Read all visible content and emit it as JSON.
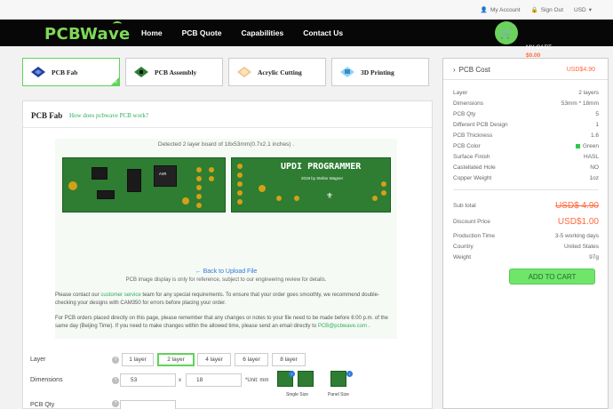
{
  "topbar": {
    "my_account": "My Account",
    "sign_out": "Sign Out",
    "currency": "USD"
  },
  "nav": {
    "logo": "PCBWave",
    "items": [
      "Home",
      "PCB Quote",
      "Capabilities",
      "Contact Us"
    ],
    "cart_label": "MY CART",
    "cart_amount": "$0.00"
  },
  "tabs": [
    {
      "label": "PCB Fab",
      "active": true
    },
    {
      "label": "PCB Assembly",
      "active": false
    },
    {
      "label": "Acrylic Cutting",
      "active": false
    },
    {
      "label": "3D Printing",
      "active": false
    }
  ],
  "main": {
    "title": "PCB Fab",
    "help_link": "How does pcbwave PCB work?",
    "detected": "Detected 2 layer board of 18x53mm(0.7x2.1 inches) .",
    "board_title": "UPDI PROGRAMMER",
    "board_sub": "2019 by Stefan Wagner",
    "back_link": "Back to Upload File",
    "image_note": "PCB image display is only for reference, subject to our engineering review for details.",
    "para1_a": "Please contact our ",
    "para1_link": "customer service",
    "para1_b": " team for any special requirements. To ensure that your order goes smoothly, we recommend double-checking your designs with CAM350 for errors before placing your order.",
    "para2_a": "For PCB orders placed directly on this page, please remember that any changes or notes to your file need to be made before 6:00 p.m. of the same day (Beijing Time). If you need to make changes within the allowed time, please send an email directly to ",
    "para2_link": "PCB@pcbwave.com",
    "para2_b": " .",
    "layer_label": "Layer",
    "layer_options": [
      "1 layer",
      "2 layer",
      "4 layer",
      "6 layer",
      "8 layer"
    ],
    "dimensions_label": "Dimensions",
    "dim_w": "53",
    "dim_x": "x",
    "dim_h": "18",
    "unit_note": "*Unit: mm",
    "single_size": "Single Size",
    "panel_size": "Panel Size",
    "qty_label": "PCB Qty"
  },
  "side": {
    "title": "PCB Cost",
    "total": "USD$4.90",
    "specs": [
      {
        "k": "Layer",
        "v": "2 layers"
      },
      {
        "k": "Dimensions",
        "v": "53mm * 18mm"
      },
      {
        "k": "PCB Qty",
        "v": "5"
      },
      {
        "k": "Different PCB Design",
        "v": "1"
      },
      {
        "k": "PCB Thickness",
        "v": "1.6"
      },
      {
        "k": "PCB Color",
        "v": "Green"
      },
      {
        "k": "Surface Finish",
        "v": "HASL"
      },
      {
        "k": "Castellated Hole",
        "v": "NO"
      },
      {
        "k": "Copper Weight",
        "v": "1oz"
      }
    ],
    "subtotal_label": "Sub total",
    "subtotal": "USD$ 4.90",
    "discount_label": "Discount Price",
    "discount": "USD$1.00",
    "prod_label": "Production Time",
    "prod": "3-5 working days",
    "country_label": "Country",
    "country": "United States",
    "weight_label": "Weight",
    "weight": "97g",
    "add_button": "ADD TO CART",
    "color_swatch": "#2ec94a"
  }
}
